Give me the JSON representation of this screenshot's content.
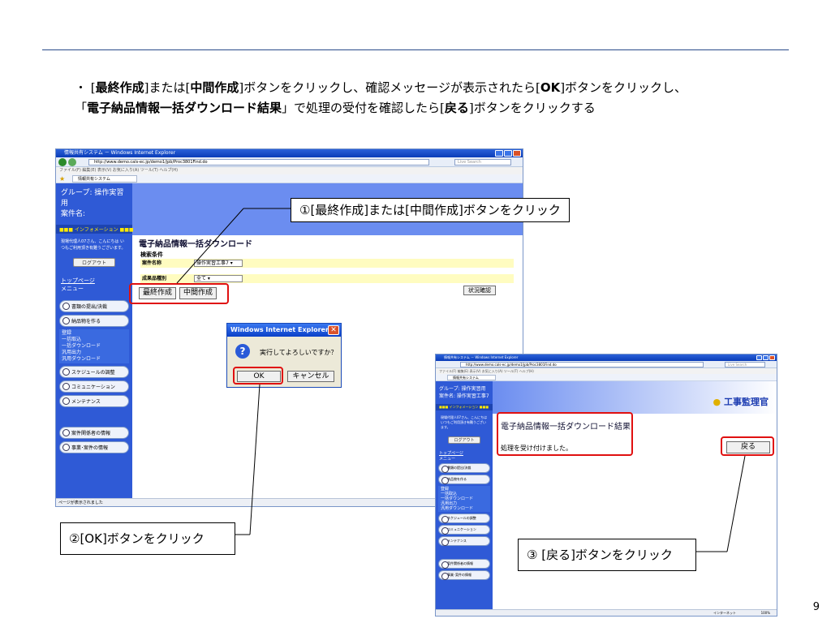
{
  "instruction": {
    "bullet": "・",
    "p1": "[",
    "b1": "最終作成",
    "p2": "]または[",
    "b2": "中間作成",
    "p3": "]ボタンをクリックし、確認メッセージが表示されたら[",
    "b3": "OK",
    "p4": "]ボタンをクリックし、",
    "p5": "「",
    "b4": "電子納品情報一括ダウンロード結果",
    "p6": "」で処理の受付を確認したら[",
    "b5": "戻る",
    "p7": "]ボタンをクリックする"
  },
  "page_number": "9",
  "callouts": {
    "c1": "①[最終作成]または[中間作成]ボタンをクリック",
    "c2": "②[OK]ボタンをクリック",
    "c3": "③ [戻る]ボタンをクリック"
  },
  "browser": {
    "title": "情報共有システム － Windows Internet Explorer",
    "address": "http://www.demo.cals-ec.jp/demo1/jpb/Proc3801Find.do",
    "live_search": "Live Search",
    "menu": "ファイル(F)  編集(E)  表示(V)  お気に入り(A)  ツール(T)  ヘルプ(H)",
    "fav_tab": "情報共有システム",
    "status_left": "ページが表示されました",
    "status_right": "インターネット",
    "zoom": "100%"
  },
  "sidebar": {
    "group": "グループ: 操作実習用",
    "case": "案件名:",
    "case2": "案件名: 操作実習工事7",
    "info": "■■■ インフォメーション ■■■",
    "note": "現場代理人07さん、こんにちは いつもご利用頂き有難うございます。",
    "logout": "ログアウト",
    "top": "トップページ",
    "menu": "メニュー",
    "nav1": "書類の提出/決裁",
    "nav2": "納品物を作る",
    "sub": [
      "登録",
      "一括取込",
      "一括ダウンロード",
      "汎用出力",
      "汎用ダウンロード"
    ],
    "nav3": "スケジュールの調整",
    "nav4": "コミュニケーション",
    "nav5": "メンテナンス",
    "nav6": "案件関係者の情報",
    "nav7": "事業･案件の情報"
  },
  "form": {
    "title": "電子納品情報一括ダウンロード",
    "search_label": "検索条件",
    "case_label": "案件名称",
    "case_value": "操作実習工事7",
    "kind_label": "成果品種別",
    "kind_value": "全て",
    "btn_final": "最終作成",
    "btn_mid": "中間作成",
    "btn_status": "状況確認"
  },
  "dialog": {
    "title": "Windows Internet Explorer",
    "message": "実行してよろしいですか？",
    "ok": "OK",
    "cancel": "キャンセル"
  },
  "result": {
    "title": "電子納品情報一括ダウンロード結果",
    "message": "処理を受け付けました。",
    "back": "戻る",
    "logo": "工事監理官"
  }
}
